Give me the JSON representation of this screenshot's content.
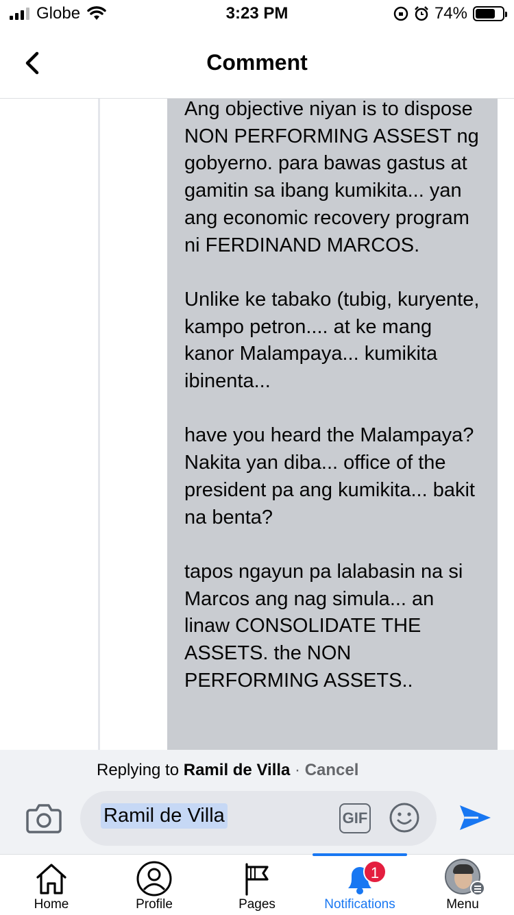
{
  "status_bar": {
    "carrier": "Globe",
    "time": "3:23 PM",
    "battery": "74%",
    "battery_level": 0.74
  },
  "header": {
    "title": "Comment"
  },
  "comment": {
    "paragraphs": [
      "Ang objective niyan is to dispose NON PERFORMING ASSEST ng gobyerno. para bawas gastus at gamitin sa ibang kumikita... yan ang economic recovery program ni FERDINAND MARCOS.",
      "Unlike ke tabako (tubig, kuryente, kampo petron.... at ke mang kanor Malampaya... kumikita ibinenta...",
      "have you heard the Malampaya? Nakita yan diba... office of the president pa ang kumikita... bakit na benta?",
      "tapos ngayun pa lalabasin na si Marcos ang nag simula... an linaw CONSOLIDATE THE ASSETS. the NON PERFORMING ASSETS.."
    ]
  },
  "reply": {
    "replying_prefix": "Replying to",
    "replying_name": "Ramil de Villa",
    "separator": "·",
    "cancel_label": "Cancel",
    "input_mention": "Ramil de Villa",
    "gif_label": "GIF"
  },
  "tabs": [
    {
      "label": "Home",
      "icon": "home-icon"
    },
    {
      "label": "Profile",
      "icon": "profile-icon"
    },
    {
      "label": "Pages",
      "icon": "flag-icon"
    },
    {
      "label": "Notifications",
      "icon": "bell-icon",
      "badge": "1",
      "active": true
    },
    {
      "label": "Menu",
      "icon": "avatar"
    }
  ],
  "colors": {
    "accent": "#1877f2",
    "badge": "#e41e3f",
    "bubble": "#c9ccd1"
  }
}
